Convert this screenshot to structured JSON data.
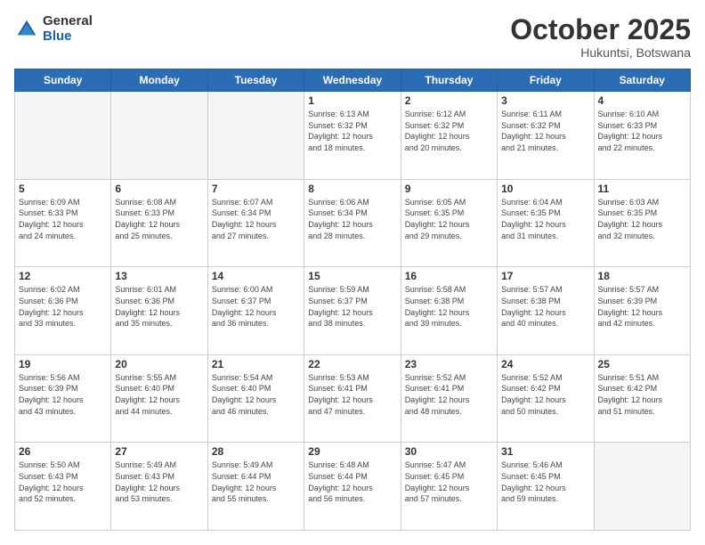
{
  "header": {
    "logo_general": "General",
    "logo_blue": "Blue",
    "month": "October 2025",
    "location": "Hukuntsi, Botswana"
  },
  "weekdays": [
    "Sunday",
    "Monday",
    "Tuesday",
    "Wednesday",
    "Thursday",
    "Friday",
    "Saturday"
  ],
  "weeks": [
    [
      {
        "day": "",
        "info": ""
      },
      {
        "day": "",
        "info": ""
      },
      {
        "day": "",
        "info": ""
      },
      {
        "day": "1",
        "info": "Sunrise: 6:13 AM\nSunset: 6:32 PM\nDaylight: 12 hours\nand 18 minutes."
      },
      {
        "day": "2",
        "info": "Sunrise: 6:12 AM\nSunset: 6:32 PM\nDaylight: 12 hours\nand 20 minutes."
      },
      {
        "day": "3",
        "info": "Sunrise: 6:11 AM\nSunset: 6:32 PM\nDaylight: 12 hours\nand 21 minutes."
      },
      {
        "day": "4",
        "info": "Sunrise: 6:10 AM\nSunset: 6:33 PM\nDaylight: 12 hours\nand 22 minutes."
      }
    ],
    [
      {
        "day": "5",
        "info": "Sunrise: 6:09 AM\nSunset: 6:33 PM\nDaylight: 12 hours\nand 24 minutes."
      },
      {
        "day": "6",
        "info": "Sunrise: 6:08 AM\nSunset: 6:33 PM\nDaylight: 12 hours\nand 25 minutes."
      },
      {
        "day": "7",
        "info": "Sunrise: 6:07 AM\nSunset: 6:34 PM\nDaylight: 12 hours\nand 27 minutes."
      },
      {
        "day": "8",
        "info": "Sunrise: 6:06 AM\nSunset: 6:34 PM\nDaylight: 12 hours\nand 28 minutes."
      },
      {
        "day": "9",
        "info": "Sunrise: 6:05 AM\nSunset: 6:35 PM\nDaylight: 12 hours\nand 29 minutes."
      },
      {
        "day": "10",
        "info": "Sunrise: 6:04 AM\nSunset: 6:35 PM\nDaylight: 12 hours\nand 31 minutes."
      },
      {
        "day": "11",
        "info": "Sunrise: 6:03 AM\nSunset: 6:35 PM\nDaylight: 12 hours\nand 32 minutes."
      }
    ],
    [
      {
        "day": "12",
        "info": "Sunrise: 6:02 AM\nSunset: 6:36 PM\nDaylight: 12 hours\nand 33 minutes."
      },
      {
        "day": "13",
        "info": "Sunrise: 6:01 AM\nSunset: 6:36 PM\nDaylight: 12 hours\nand 35 minutes."
      },
      {
        "day": "14",
        "info": "Sunrise: 6:00 AM\nSunset: 6:37 PM\nDaylight: 12 hours\nand 36 minutes."
      },
      {
        "day": "15",
        "info": "Sunrise: 5:59 AM\nSunset: 6:37 PM\nDaylight: 12 hours\nand 38 minutes."
      },
      {
        "day": "16",
        "info": "Sunrise: 5:58 AM\nSunset: 6:38 PM\nDaylight: 12 hours\nand 39 minutes."
      },
      {
        "day": "17",
        "info": "Sunrise: 5:57 AM\nSunset: 6:38 PM\nDaylight: 12 hours\nand 40 minutes."
      },
      {
        "day": "18",
        "info": "Sunrise: 5:57 AM\nSunset: 6:39 PM\nDaylight: 12 hours\nand 42 minutes."
      }
    ],
    [
      {
        "day": "19",
        "info": "Sunrise: 5:56 AM\nSunset: 6:39 PM\nDaylight: 12 hours\nand 43 minutes."
      },
      {
        "day": "20",
        "info": "Sunrise: 5:55 AM\nSunset: 6:40 PM\nDaylight: 12 hours\nand 44 minutes."
      },
      {
        "day": "21",
        "info": "Sunrise: 5:54 AM\nSunset: 6:40 PM\nDaylight: 12 hours\nand 46 minutes."
      },
      {
        "day": "22",
        "info": "Sunrise: 5:53 AM\nSunset: 6:41 PM\nDaylight: 12 hours\nand 47 minutes."
      },
      {
        "day": "23",
        "info": "Sunrise: 5:52 AM\nSunset: 6:41 PM\nDaylight: 12 hours\nand 48 minutes."
      },
      {
        "day": "24",
        "info": "Sunrise: 5:52 AM\nSunset: 6:42 PM\nDaylight: 12 hours\nand 50 minutes."
      },
      {
        "day": "25",
        "info": "Sunrise: 5:51 AM\nSunset: 6:42 PM\nDaylight: 12 hours\nand 51 minutes."
      }
    ],
    [
      {
        "day": "26",
        "info": "Sunrise: 5:50 AM\nSunset: 6:43 PM\nDaylight: 12 hours\nand 52 minutes."
      },
      {
        "day": "27",
        "info": "Sunrise: 5:49 AM\nSunset: 6:43 PM\nDaylight: 12 hours\nand 53 minutes."
      },
      {
        "day": "28",
        "info": "Sunrise: 5:49 AM\nSunset: 6:44 PM\nDaylight: 12 hours\nand 55 minutes."
      },
      {
        "day": "29",
        "info": "Sunrise: 5:48 AM\nSunset: 6:44 PM\nDaylight: 12 hours\nand 56 minutes."
      },
      {
        "day": "30",
        "info": "Sunrise: 5:47 AM\nSunset: 6:45 PM\nDaylight: 12 hours\nand 57 minutes."
      },
      {
        "day": "31",
        "info": "Sunrise: 5:46 AM\nSunset: 6:45 PM\nDaylight: 12 hours\nand 59 minutes."
      },
      {
        "day": "",
        "info": ""
      }
    ]
  ]
}
